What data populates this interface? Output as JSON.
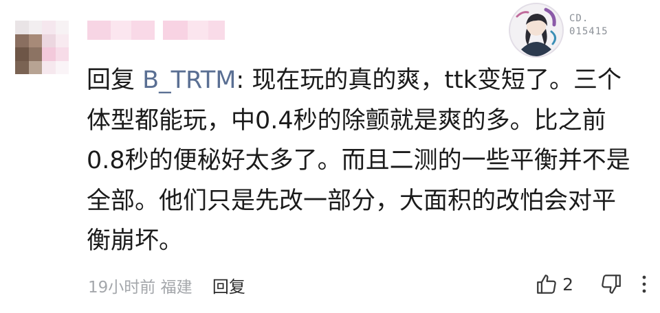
{
  "comment": {
    "reply_label": "回复",
    "reply_target": "B_TRTM",
    "lines": [
      ": 现在玩的真的爽，ttk变短了。三个",
      "体型都能玩，中0.4秒的除颤就是爽的多。比之前",
      "0.8秒的便秘好太多了。而且二测的一些平衡并不是",
      "全部。他们只是先改一部分，大面积的改怕会对平",
      "衡崩坏。"
    ],
    "time": "19小时前",
    "location": "福建",
    "reply_button": "回复",
    "like_count": "2"
  },
  "badge": {
    "code_line1": "CD.",
    "code_line2": "015415"
  },
  "icons": {
    "like": "thumbs-up-icon",
    "dislike": "thumbs-down-icon",
    "more": "more-vertical-icon"
  },
  "colors": {
    "text": "#1b1b1b",
    "reply_target": "#5a6f93",
    "meta": "#a4a7ab"
  }
}
